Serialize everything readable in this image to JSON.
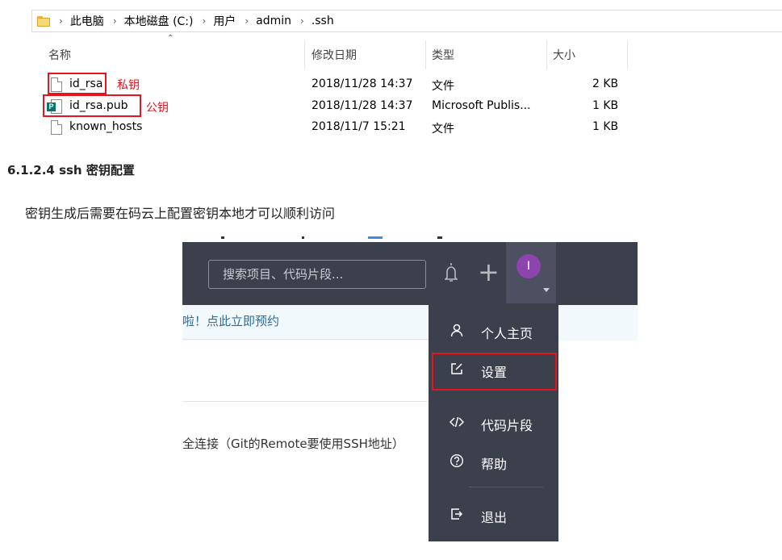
{
  "explorer": {
    "breadcrumb": [
      "此电脑",
      "本地磁盘 (C:)",
      "用户",
      "admin",
      ".ssh"
    ],
    "columns": {
      "name": "名称",
      "modified": "修改日期",
      "type": "类型",
      "size": "大小"
    },
    "files": [
      {
        "name": "id_rsa",
        "modified": "2018/11/28 14:37",
        "type": "文件",
        "size": "2 KB",
        "note": "私钥"
      },
      {
        "name": "id_rsa.pub",
        "modified": "2018/11/28 14:37",
        "type": "Microsoft Publis...",
        "size": "1 KB",
        "note": "公钥"
      },
      {
        "name": "known_hosts",
        "modified": "2018/11/7 15:21",
        "type": "文件",
        "size": "1 KB"
      }
    ]
  },
  "doc": {
    "heading": "6.1.2.4 ssh 密钥配置",
    "paragraph": "密钥生成后需要在码云上配置密钥本地才可以顺利访问"
  },
  "gitee": {
    "search_placeholder": "搜索项目、代码片段...",
    "avatar_letter": "I",
    "banner_text": "啦！点此立即预约",
    "ssh_text": "全连接（Git的Remote要使用SSH地址）",
    "menu": [
      {
        "label": "个人主页",
        "icon": "user-icon"
      },
      {
        "label": "设置",
        "icon": "edit-icon"
      },
      {
        "label": "代码片段",
        "icon": "code-icon"
      },
      {
        "label": "帮助",
        "icon": "help-icon"
      },
      {
        "label": "退出",
        "icon": "logout-icon"
      }
    ]
  },
  "colors": {
    "highlight_red": "#e8141d",
    "gitee_nav": "#3c3f4c",
    "avatar_purple": "#8e44ad"
  }
}
